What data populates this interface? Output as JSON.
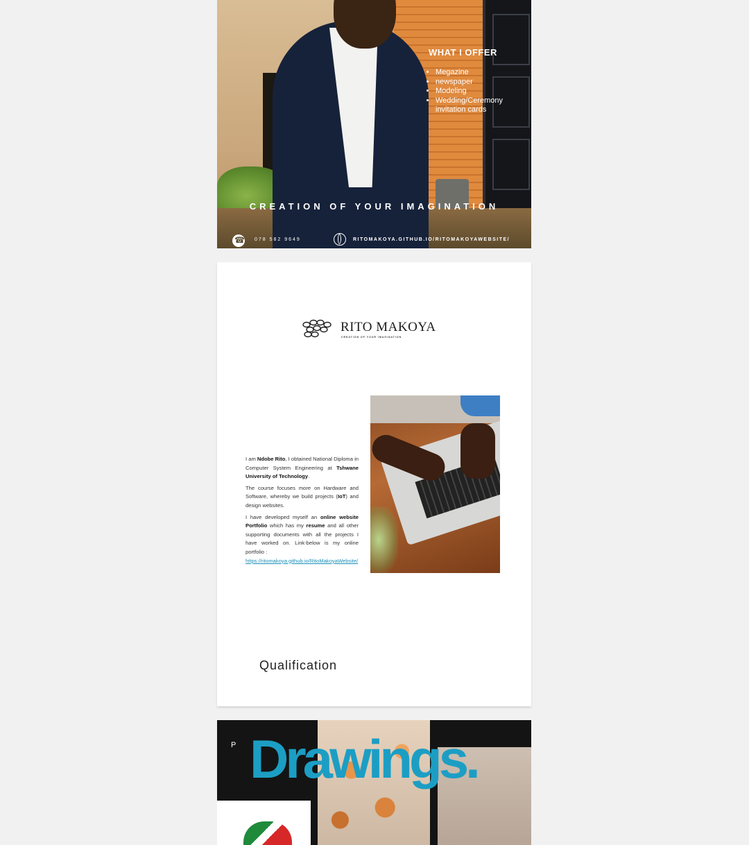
{
  "poster": {
    "offer_title": "WHAT I OFFER",
    "offer_items": [
      "Megazine",
      "newspaper",
      "Modeling",
      "Wedding/Ceremony invitation cards"
    ],
    "tagline": "CREATION OF YOUR IMAGINATION",
    "phone": "078 582 9649",
    "website": "RITOMAKOYA.GITHUB.IO/RITOMAKOYAWEBSITE/"
  },
  "profile_page": {
    "brand_name": "RITO MAKOYA",
    "brand_tagline": "CREATION OF YOUR IMAGINATION",
    "bio": {
      "p1_intro": "I am ",
      "p1_name": "Ndobe Rito",
      "p1_mid": ", I obtained National Diploma in Computer System Engineering at ",
      "p1_school": "Tshwane University of Technology",
      "p1_end": ".",
      "p2_start": "The course focuses more on Hardware and Software, whereby we build projects (",
      "p2_iot": "IoT",
      "p2_end": ") and design websites.",
      "p3_start": "I have developed myself an ",
      "p3_portfolio": "online website Portfolio",
      "p3_mid": " which has my ",
      "p3_resume": "resume",
      "p3_end": " and all other supporting documents with all the projects I have worked on. Link-below is my online portfolio :",
      "link": "https://ritomakoya.github.io/RitoMakoyaWebsite/"
    },
    "section_heading": "Qualification"
  },
  "drawings_page": {
    "letter": "P",
    "title": "Drawings."
  }
}
